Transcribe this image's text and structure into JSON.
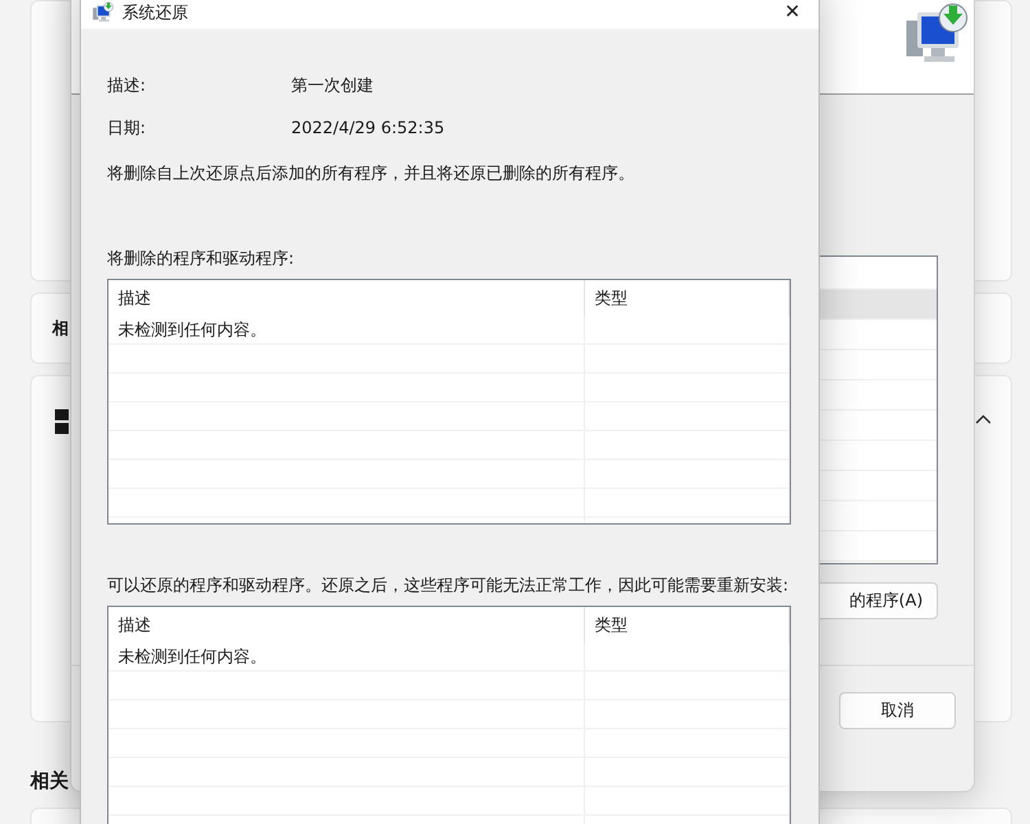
{
  "settings_page": {
    "cards": [
      {
        "kind": "plain"
      },
      {
        "kind": "label",
        "label": "相"
      },
      {
        "kind": "expandable",
        "expanded": true
      }
    ],
    "section_heading": "相关"
  },
  "restore_wizard": {
    "list_rows": [
      {
        "selected": false
      },
      {
        "selected": true
      },
      {
        "selected": false
      },
      {
        "selected": false
      },
      {
        "selected": false
      },
      {
        "selected": false
      },
      {
        "selected": false
      },
      {
        "selected": false
      },
      {
        "selected": false
      },
      {
        "selected": false
      }
    ],
    "scan_button": "的程序(A)",
    "cancel_button": "取消"
  },
  "dialog": {
    "title": "系统还原",
    "close": "✕",
    "fields": [
      {
        "label": "描述:",
        "value": "第一次创建"
      },
      {
        "label": "日期:",
        "value": "2022/4/29 6:52:35"
      }
    ],
    "note": "将删除自上次还原点后添加的所有程序，并且将还原已删除的所有程序。",
    "lists": [
      {
        "caption": "将删除的程序和驱动程序:",
        "columns": [
          "描述",
          "类型"
        ],
        "rows": [
          {
            "cells": [
              "未检测到任何内容。"
            ]
          }
        ]
      },
      {
        "caption": "可以还原的程序和驱动程序。还原之后，这些程序可能无法正常工作，因此可能需要重新安装:",
        "columns": [
          "描述",
          "类型"
        ],
        "rows": [
          {
            "cells": [
              "未检测到任何内容。"
            ]
          }
        ]
      }
    ]
  }
}
